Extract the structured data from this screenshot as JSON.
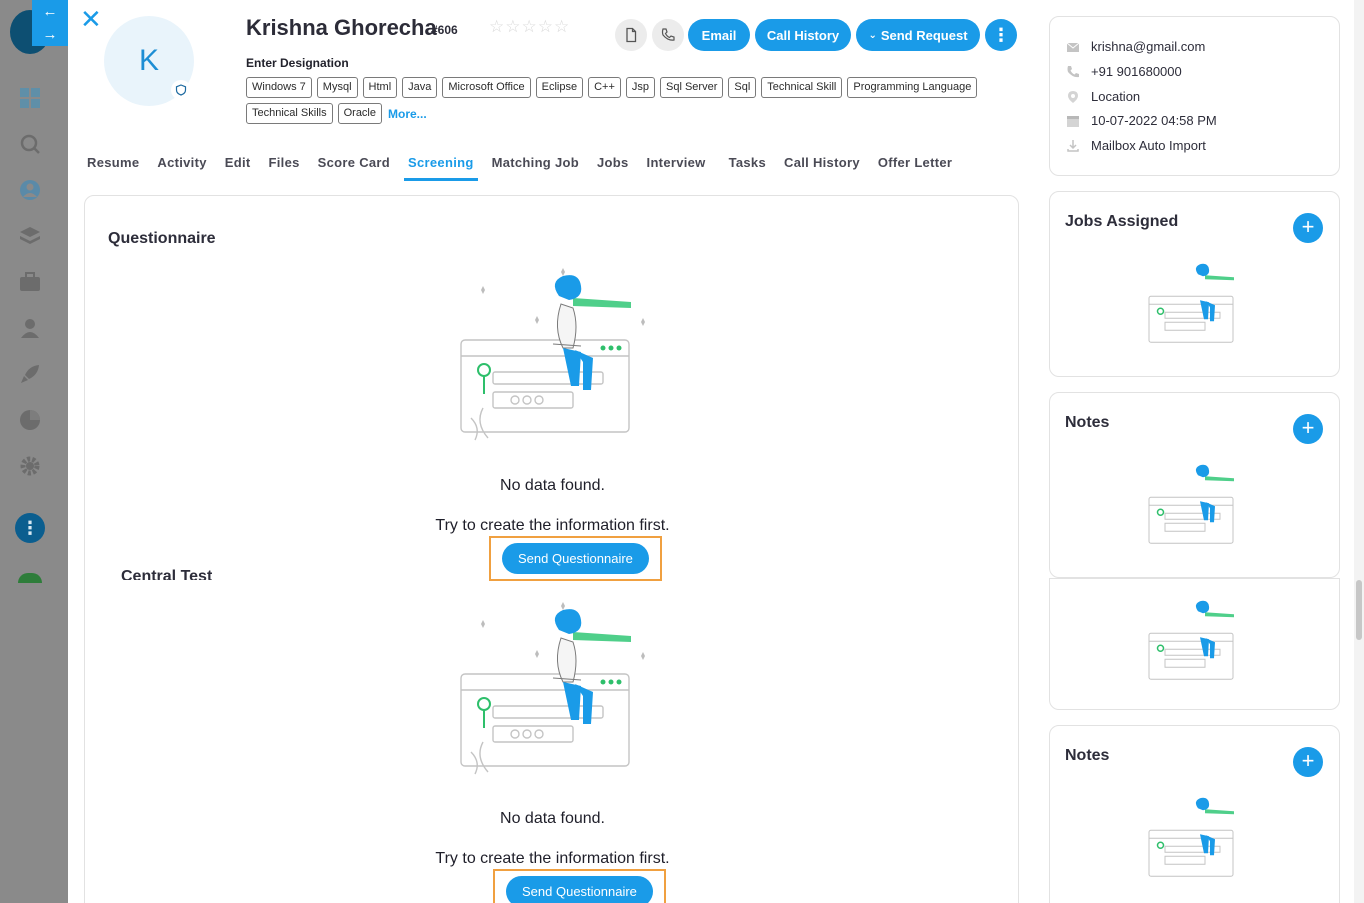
{
  "candidate": {
    "initial": "K",
    "name": "Krishna Ghorecha",
    "id": "#606",
    "designation": "Enter Designation",
    "skills": [
      "Windows 7",
      "Mysql",
      "Html",
      "Java",
      "Microsoft Office",
      "Eclipse",
      "C++",
      "Jsp",
      "Sql Server",
      "Sql",
      "Technical Skill",
      "Programming Language",
      "Technical Skills",
      "Oracle"
    ],
    "more_label": "More...",
    "rating": 0
  },
  "actions": {
    "email": "Email",
    "call_history": "Call History",
    "send_request": "Send Request"
  },
  "tabs": [
    "Resume",
    "Activity",
    "Edit",
    "Files",
    "Score Card",
    "Screening",
    "Matching Job",
    "Jobs",
    "Interview",
    "Tasks",
    "Call History",
    "Offer Letter"
  ],
  "active_tab": "Screening",
  "screening": {
    "questionnaire": {
      "title": "Questionnaire",
      "empty_title": "No data found.",
      "empty_subtitle": "Try to create the information first.",
      "button": "Send Questionnaire"
    },
    "central_test": {
      "title": "Central Test",
      "empty_title": "No data found.",
      "empty_subtitle": "Try to create the information first.",
      "button": "Send Questionnaire"
    }
  },
  "contact": {
    "email": "krishna@gmail.com",
    "phone": "+91 901680000",
    "location": "Location",
    "date": "10-07-2022 04:58 PM",
    "source": "Mailbox Auto Import"
  },
  "side_panels": {
    "jobs_assigned": "Jobs Assigned",
    "notes_1": "Notes",
    "notes_2": "Notes"
  },
  "colors": {
    "accent": "#1a9be8",
    "highlight": "#f0a040"
  }
}
